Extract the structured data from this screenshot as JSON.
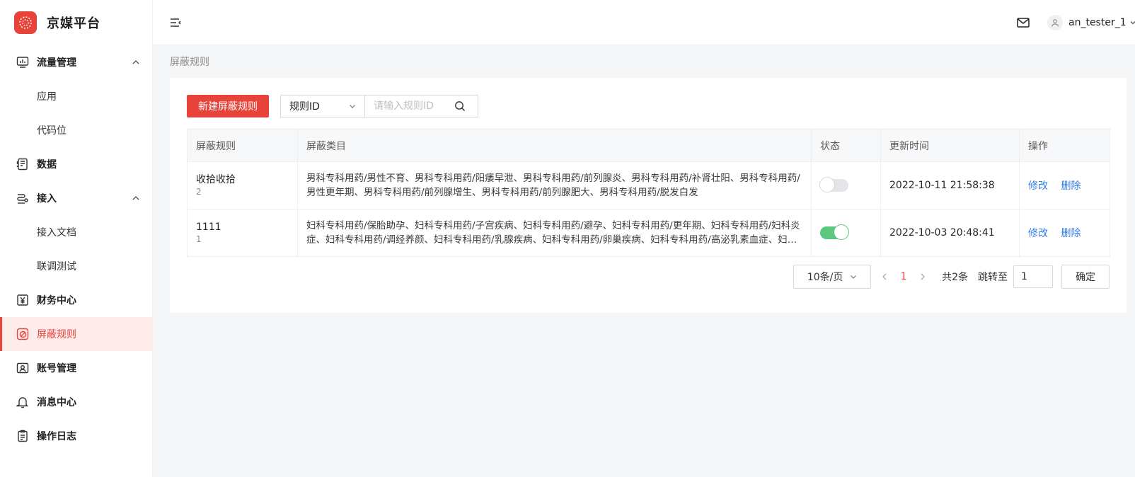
{
  "brand": {
    "name": "京媒平台",
    "accent": "#e8433a"
  },
  "sidebar": {
    "items": [
      {
        "label": "流量管理",
        "icon": "chart-monitor-icon",
        "expanded": true
      },
      {
        "label": "应用",
        "sub": true
      },
      {
        "label": "代码位",
        "sub": true
      },
      {
        "label": "数据",
        "icon": "data-sheet-icon"
      },
      {
        "label": "接入",
        "icon": "access-connect-icon",
        "expanded": true
      },
      {
        "label": "接入文档",
        "sub": true
      },
      {
        "label": "联调测试",
        "sub": true
      },
      {
        "label": "财务中心",
        "icon": "yen-icon"
      },
      {
        "label": "屏蔽规则",
        "icon": "block-rule-icon",
        "active": true
      },
      {
        "label": "账号管理",
        "icon": "account-card-icon"
      },
      {
        "label": "消息中心",
        "icon": "bell-icon"
      },
      {
        "label": "操作日志",
        "icon": "clipboard-log-icon"
      }
    ]
  },
  "header": {
    "user_name": "an_tester_1"
  },
  "breadcrumb": "屏蔽规则",
  "toolbar": {
    "new_button": "新建屏蔽规则",
    "select_value": "规则ID",
    "search_placeholder": "请输入规则ID"
  },
  "table": {
    "columns": [
      "屏蔽规则",
      "屏蔽类目",
      "状态",
      "更新时间",
      "操作"
    ],
    "rows": [
      {
        "name": "收拾收拾",
        "id": "2",
        "categories": "男科专科用药/男性不育、男科专科用药/阳痿早泄、男科专科用药/前列腺炎、男科专科用药/补肾壮阳、男科专科用药/男性更年期、男科专科用药/前列腺增生、男科专科用药/前列腺肥大、男科专科用药/脱发白发",
        "status_on": false,
        "updated": "2022-10-11 21:58:38",
        "edit": "修改",
        "delete": "删除"
      },
      {
        "name": "1111",
        "id": "1",
        "categories": "妇科专科用药/保胎助孕、妇科专科用药/子宫疾病、妇科专科用药/避孕、妇科专科用药/更年期、妇科专科用药/妇科炎症、妇科专科用药/调经养颜、妇科专科用药/乳腺疾病、妇科专科用药/卵巢疾病、妇科专科用药/高泌乳素血症、妇科专科用药/其他",
        "status_on": true,
        "updated": "2022-10-03 20:48:41",
        "edit": "修改",
        "delete": "删除"
      }
    ]
  },
  "pagination": {
    "page_size": "10条/页",
    "current_page": "1",
    "total": "共2条",
    "jump_label": "跳转至",
    "jump_value": "1",
    "confirm": "确定"
  },
  "colors": {
    "primary": "#e8433a",
    "link": "#2f7dea",
    "switch_on": "#5cc77f"
  }
}
